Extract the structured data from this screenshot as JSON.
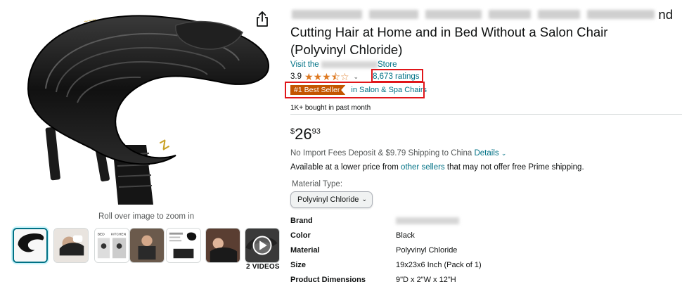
{
  "product": {
    "title_line_2": "Cutting Hair at Home and in Bed Without a Salon Chair",
    "title_line_3": "(Polyvinyl Chloride)",
    "title_tail": "nd",
    "store_prefix": "Visit the",
    "store_suffix": "Store",
    "rating_value": "3.9",
    "ratings_count": "8,673 ratings",
    "best_seller_badge": "#1 Best Seller",
    "best_seller_category": "in Salon & Spa Chairs",
    "bought_text": "1K+ bought in past month",
    "price": {
      "symbol": "$",
      "whole": "26",
      "fraction": "93"
    },
    "shipping_text": "No Import Fees Deposit & $9.79 Shipping to China",
    "shipping_details": "Details",
    "lower_price_pre": "Available at a lower price from",
    "lower_price_link": "other sellers",
    "lower_price_post": "that may not offer free Prime shipping.",
    "material_type_label": "Material Type:",
    "material_selected": "Polyvinyl Chloride"
  },
  "gallery": {
    "zoom_hint": "Roll over image to zoom in",
    "videos_label": "2 VIDEOS",
    "thumb_labels": {
      "bed": "BED",
      "kitchen": "KITCHEN"
    }
  },
  "specs": [
    {
      "key": "Brand",
      "value": ""
    },
    {
      "key": "Color",
      "value": "Black"
    },
    {
      "key": "Material",
      "value": "Polyvinyl Chloride"
    },
    {
      "key": "Size",
      "value": "19x23x6 Inch (Pack of 1)"
    },
    {
      "key": "Product Dimensions",
      "value": "9\"D x 2\"W x 12\"H"
    }
  ],
  "rating_stars": {
    "full": 3,
    "half": 1,
    "empty": 1
  },
  "colors": {
    "link": "#007185",
    "badge": "#c45500",
    "star": "#de7921",
    "highlight_box": "#e0161a"
  },
  "icons": {
    "share": "share-icon",
    "play": "play-icon",
    "chevron": "chevron-down-icon"
  }
}
